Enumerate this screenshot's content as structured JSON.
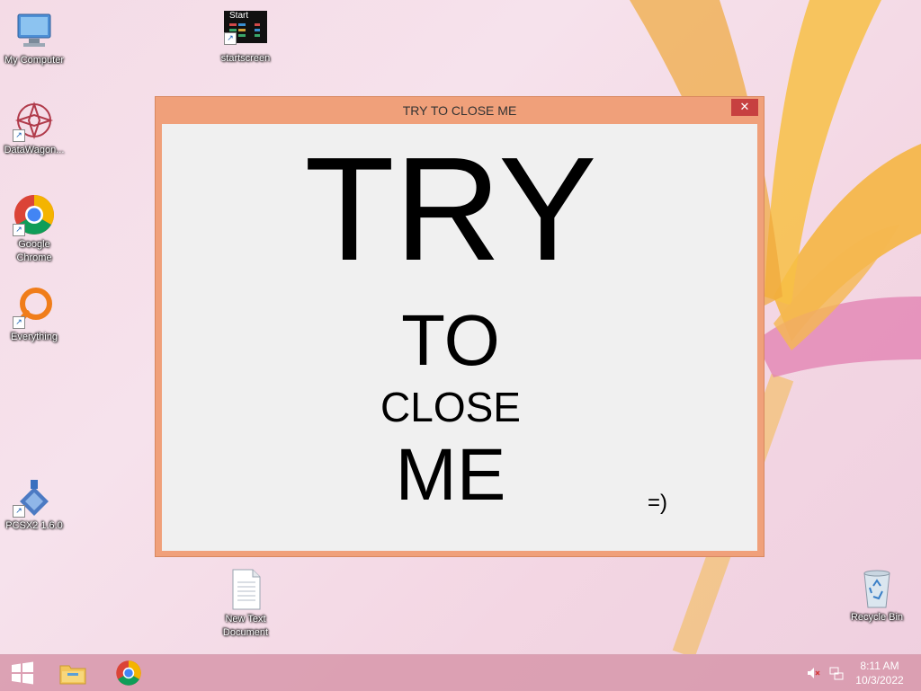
{
  "desktop": {
    "icons": [
      {
        "label": "My Computer",
        "icon": "computer-icon"
      },
      {
        "label": "DataWagon...",
        "icon": "datawagon-icon"
      },
      {
        "label": "Google Chrome",
        "icon": "chrome-icon"
      },
      {
        "label": "Everything",
        "icon": "everything-icon"
      },
      {
        "label": "PCSX2 1.6.0",
        "icon": "pcsx2-icon"
      },
      {
        "label": "startscreen",
        "icon": "startscreen-icon",
        "thumb_text": "Start"
      },
      {
        "label": "New Text Document",
        "icon": "text-document-icon"
      },
      {
        "label": "Recycle Bin",
        "icon": "recycle-bin-icon"
      }
    ]
  },
  "window": {
    "title": "TRY TO CLOSE ME",
    "close_glyph": "✕",
    "lines": [
      "TRY",
      "TO",
      "CLOSE",
      "ME"
    ],
    "smiley": "=)"
  },
  "taskbar": {
    "start_icon": "windows-logo-icon",
    "pinned": [
      "file-explorer-icon",
      "chrome-icon"
    ],
    "tray_icons": [
      "speaker-muted-icon",
      "network-icon"
    ],
    "time": "8:11 AM",
    "date": "10/3/2022"
  },
  "colors": {
    "window_frame": "#f0a07a",
    "close_button": "#c74040",
    "taskbar": "#d796aa"
  }
}
